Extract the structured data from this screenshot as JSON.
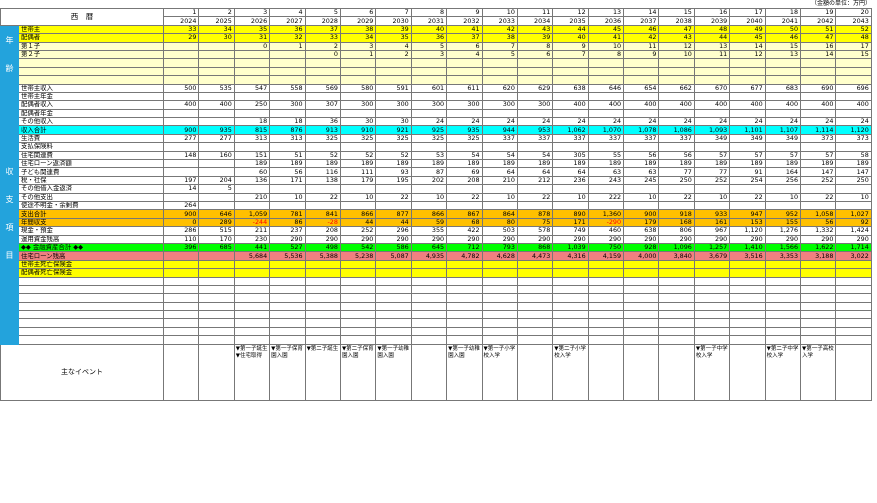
{
  "unit_note": "（金額の単位：万円）",
  "corner_label": "西　暦",
  "indices": [
    1,
    2,
    3,
    4,
    5,
    6,
    7,
    8,
    9,
    10,
    11,
    12,
    13,
    14,
    15,
    16,
    17,
    18,
    19,
    20
  ],
  "years": [
    2024,
    2025,
    2026,
    2027,
    2028,
    2029,
    2030,
    2031,
    2032,
    2033,
    2034,
    2035,
    2036,
    2037,
    2038,
    2039,
    2040,
    2041,
    2042,
    2043
  ],
  "sections": [
    {
      "label": "年\n\n齢",
      "rows": [
        {
          "label": "世帯主",
          "style": "yellow",
          "cells": [
            "33",
            "34",
            "35",
            "36",
            "37",
            "38",
            "39",
            "40",
            "41",
            "42",
            "43",
            "44",
            "45",
            "46",
            "47",
            "48",
            "49",
            "50",
            "51",
            "52"
          ]
        },
        {
          "label": "配偶者",
          "style": "yellow",
          "cells": [
            "29",
            "30",
            "31",
            "32",
            "33",
            "34",
            "35",
            "36",
            "37",
            "38",
            "39",
            "40",
            "41",
            "42",
            "43",
            "44",
            "45",
            "46",
            "47",
            "48"
          ]
        },
        {
          "label": "第１子",
          "style": "lightyellow",
          "cells": [
            "",
            "",
            "0",
            "1",
            "2",
            "3",
            "4",
            "5",
            "6",
            "7",
            "8",
            "9",
            "10",
            "11",
            "12",
            "13",
            "14",
            "15",
            "16",
            "17"
          ]
        },
        {
          "label": "第２子",
          "style": "lightyellow",
          "cells": [
            "",
            "",
            "",
            "",
            "0",
            "1",
            "2",
            "3",
            "4",
            "5",
            "6",
            "7",
            "8",
            "9",
            "10",
            "11",
            "12",
            "13",
            "14",
            "15"
          ]
        },
        {
          "label": "",
          "style": "lightyellow",
          "cells": [
            "",
            "",
            "",
            "",
            "",
            "",
            "",
            "",
            "",
            "",
            "",
            "",
            "",
            "",
            "",
            "",
            "",
            "",
            "",
            ""
          ]
        },
        {
          "label": "",
          "style": "lightyellow",
          "cells": [
            "",
            "",
            "",
            "",
            "",
            "",
            "",
            "",
            "",
            "",
            "",
            "",
            "",
            "",
            "",
            "",
            "",
            "",
            "",
            ""
          ]
        },
        {
          "label": "",
          "style": "lightyellow",
          "cells": [
            "",
            "",
            "",
            "",
            "",
            "",
            "",
            "",
            "",
            "",
            "",
            "",
            "",
            "",
            "",
            "",
            "",
            "",
            "",
            ""
          ]
        }
      ]
    },
    {
      "label": "収\n\n支\n\n項\n\n目",
      "rows": [
        {
          "label": "世帯主収入",
          "style": "",
          "cells": [
            "500",
            "535",
            "547",
            "558",
            "569",
            "580",
            "591",
            "601",
            "611",
            "620",
            "629",
            "638",
            "646",
            "654",
            "662",
            "670",
            "677",
            "683",
            "690",
            "696"
          ]
        },
        {
          "label": "世帯主年金",
          "style": "",
          "cells": [
            "",
            "",
            "",
            "",
            "",
            "",
            "",
            "",
            "",
            "",
            "",
            "",
            "",
            "",
            "",
            "",
            "",
            "",
            "",
            ""
          ]
        },
        {
          "label": "配偶者収入",
          "style": "",
          "cells": [
            "400",
            "400",
            "250",
            "300",
            "307",
            "300",
            "300",
            "300",
            "300",
            "300",
            "300",
            "400",
            "400",
            "400",
            "400",
            "400",
            "400",
            "400",
            "400",
            "400"
          ]
        },
        {
          "label": "配偶者年金",
          "style": "",
          "cells": [
            "",
            "",
            "",
            "",
            "",
            "",
            "",
            "",
            "",
            "",
            "",
            "",
            "",
            "",
            "",
            "",
            "",
            "",
            "",
            ""
          ]
        },
        {
          "label": "その他収入",
          "style": "",
          "cells": [
            "",
            "",
            "18",
            "18",
            "36",
            "30",
            "30",
            "24",
            "24",
            "24",
            "24",
            "24",
            "24",
            "24",
            "24",
            "24",
            "24",
            "24",
            "24",
            "24"
          ]
        },
        {
          "label": "収入合計",
          "style": "cyan",
          "cells": [
            "900",
            "935",
            "815",
            "876",
            "913",
            "910",
            "921",
            "925",
            "935",
            "944",
            "953",
            "1,062",
            "1,070",
            "1,078",
            "1,086",
            "1,093",
            "1,101",
            "1,107",
            "1,114",
            "1,120"
          ]
        },
        {
          "label": "生活費",
          "style": "",
          "cells": [
            "277",
            "277",
            "313",
            "313",
            "325",
            "325",
            "325",
            "325",
            "325",
            "337",
            "337",
            "337",
            "337",
            "337",
            "337",
            "349",
            "349",
            "349",
            "373",
            "373"
          ]
        },
        {
          "label": "支払保険料",
          "style": "",
          "cells": [
            "",
            "",
            "",
            "",
            "",
            "",
            "",
            "",
            "",
            "",
            "",
            "",
            "",
            "",
            "",
            "",
            "",
            "",
            "",
            ""
          ]
        },
        {
          "label": "住宅関連費",
          "style": "",
          "cells": [
            "148",
            "160",
            "151",
            "51",
            "52",
            "52",
            "52",
            "53",
            "54",
            "54",
            "54",
            "305",
            "55",
            "56",
            "56",
            "57",
            "57",
            "57",
            "57",
            "58"
          ]
        },
        {
          "label": "住宅ローン返済額",
          "style": "",
          "cells": [
            "",
            "",
            "189",
            "189",
            "189",
            "189",
            "189",
            "189",
            "189",
            "189",
            "189",
            "189",
            "189",
            "189",
            "189",
            "189",
            "189",
            "189",
            "189",
            "189"
          ]
        },
        {
          "label": "子ども関連費",
          "style": "",
          "cells": [
            "",
            "",
            "60",
            "56",
            "116",
            "111",
            "93",
            "87",
            "69",
            "64",
            "64",
            "64",
            "63",
            "63",
            "77",
            "77",
            "91",
            "164",
            "147",
            "147"
          ]
        },
        {
          "label": "税・社保",
          "style": "",
          "cells": [
            "197",
            "204",
            "136",
            "171",
            "138",
            "179",
            "195",
            "202",
            "208",
            "210",
            "212",
            "236",
            "243",
            "245",
            "250",
            "252",
            "254",
            "256",
            "252",
            "250"
          ]
        },
        {
          "label": "その他借入金返済",
          "style": "",
          "cells": [
            "14",
            "5",
            "",
            "",
            "",
            "",
            "",
            "",
            "",
            "",
            "",
            "",
            "",
            "",
            "",
            "",
            "",
            "",
            "",
            ""
          ]
        },
        {
          "label": "その他支出",
          "style": "",
          "cells": [
            "",
            "",
            "210",
            "10",
            "22",
            "10",
            "22",
            "10",
            "22",
            "10",
            "22",
            "10",
            "222",
            "10",
            "22",
            "10",
            "22",
            "10",
            "22",
            "10"
          ]
        },
        {
          "label": "使途不明金・余剰費",
          "style": "",
          "cells": [
            "264",
            "",
            "",
            "",
            "",
            "",
            "",
            "",
            "",
            "",
            "",
            "",
            "",
            "",
            "",
            "",
            "",
            "",
            "",
            ""
          ]
        },
        {
          "label": "支出合計",
          "style": "orange",
          "cells": [
            "900",
            "646",
            "1,059",
            "781",
            "841",
            "866",
            "877",
            "866",
            "867",
            "864",
            "878",
            "890",
            "1,360",
            "900",
            "918",
            "933",
            "947",
            "952",
            "1,058",
            "1,027"
          ]
        },
        {
          "label": "年間収支",
          "style": "orange",
          "cells": [
            "0",
            "289",
            "-244",
            "86",
            "-28",
            "44",
            "44",
            "59",
            "68",
            "80",
            "75",
            "171",
            "-290",
            "179",
            "168",
            "161",
            "153",
            "155",
            "56",
            "92"
          ]
        },
        {
          "label": "現金・預金",
          "style": "",
          "cells": [
            "286",
            "515",
            "211",
            "237",
            "208",
            "252",
            "296",
            "355",
            "422",
            "503",
            "578",
            "749",
            "460",
            "638",
            "806",
            "967",
            "1,120",
            "1,276",
            "1,332",
            "1,424"
          ]
        },
        {
          "label": "運用資金残高",
          "style": "",
          "cells": [
            "110",
            "170",
            "230",
            "290",
            "290",
            "290",
            "290",
            "290",
            "290",
            "290",
            "290",
            "290",
            "290",
            "290",
            "290",
            "290",
            "290",
            "290",
            "290",
            "290"
          ]
        },
        {
          "label": "◆◆ 金融資産合計 ◆◆",
          "style": "green",
          "cells": [
            "396",
            "685",
            "441",
            "527",
            "498",
            "542",
            "586",
            "645",
            "712",
            "793",
            "868",
            "1,039",
            "750",
            "928",
            "1,096",
            "1,257",
            "1,410",
            "1,566",
            "1,622",
            "1,714"
          ]
        },
        {
          "label": "住宅ローン残高",
          "style": "pink",
          "cells": [
            "",
            "",
            "5,684",
            "5,536",
            "5,388",
            "5,238",
            "5,087",
            "4,935",
            "4,782",
            "4,628",
            "4,473",
            "4,316",
            "4,159",
            "4,000",
            "3,840",
            "3,679",
            "3,516",
            "3,353",
            "3,188",
            "3,022"
          ]
        },
        {
          "label": "世帯主死亡保険金",
          "style": "yellow",
          "cells": [
            "",
            "",
            "",
            "",
            "",
            "",
            "",
            "",
            "",
            "",
            "",
            "",
            "",
            "",
            "",
            "",
            "",
            "",
            "",
            ""
          ]
        },
        {
          "label": "配偶者死亡保険金",
          "style": "yellow",
          "cells": [
            "",
            "",
            "",
            "",
            "",
            "",
            "",
            "",
            "",
            "",
            "",
            "",
            "",
            "",
            "",
            "",
            "",
            "",
            "",
            ""
          ]
        },
        {
          "label": "",
          "style": "",
          "cells": [
            "",
            "",
            "",
            "",
            "",
            "",
            "",
            "",
            "",
            "",
            "",
            "",
            "",
            "",
            "",
            "",
            "",
            "",
            "",
            ""
          ]
        },
        {
          "label": "",
          "style": "",
          "cells": [
            "",
            "",
            "",
            "",
            "",
            "",
            "",
            "",
            "",
            "",
            "",
            "",
            "",
            "",
            "",
            "",
            "",
            "",
            "",
            ""
          ]
        },
        {
          "label": "",
          "style": "",
          "cells": [
            "",
            "",
            "",
            "",
            "",
            "",
            "",
            "",
            "",
            "",
            "",
            "",
            "",
            "",
            "",
            "",
            "",
            "",
            "",
            ""
          ]
        },
        {
          "label": "",
          "style": "",
          "cells": [
            "",
            "",
            "",
            "",
            "",
            "",
            "",
            "",
            "",
            "",
            "",
            "",
            "",
            "",
            "",
            "",
            "",
            "",
            "",
            ""
          ]
        },
        {
          "label": "",
          "style": "",
          "cells": [
            "",
            "",
            "",
            "",
            "",
            "",
            "",
            "",
            "",
            "",
            "",
            "",
            "",
            "",
            "",
            "",
            "",
            "",
            "",
            ""
          ]
        },
        {
          "label": "",
          "style": "",
          "cells": [
            "",
            "",
            "",
            "",
            "",
            "",
            "",
            "",
            "",
            "",
            "",
            "",
            "",
            "",
            "",
            "",
            "",
            "",
            "",
            ""
          ]
        },
        {
          "label": "",
          "style": "",
          "cells": [
            "",
            "",
            "",
            "",
            "",
            "",
            "",
            "",
            "",
            "",
            "",
            "",
            "",
            "",
            "",
            "",
            "",
            "",
            "",
            ""
          ]
        },
        {
          "label": "",
          "style": "",
          "cells": [
            "",
            "",
            "",
            "",
            "",
            "",
            "",
            "",
            "",
            "",
            "",
            "",
            "",
            "",
            "",
            "",
            "",
            "",
            "",
            ""
          ]
        }
      ]
    }
  ],
  "events_label": "主なイベント",
  "events": [
    "",
    "",
    "▼第一子誕生\n▼住宅取得",
    "▼第一子保育園入園",
    "▼第二子誕生",
    "▼第二子保育園入園",
    "▼第一子幼稚園入園",
    "",
    "▼第一子幼稚園入園",
    "▼第一子小学校入学",
    "",
    "▼第二子小学校入学",
    "",
    "",
    "",
    "▼第一子中学校入学",
    "",
    "▼第二子中学校入学",
    "▼第一子高校入学",
    ""
  ],
  "colors": {
    "section_blue": "#23a3dc",
    "yellow": "#ffff00",
    "light_yellow": "#ffffcc",
    "cyan": "#00ffff",
    "orange": "#ffc000",
    "green": "#00ff00",
    "pink": "#f08080",
    "negative": "#ff0000"
  }
}
